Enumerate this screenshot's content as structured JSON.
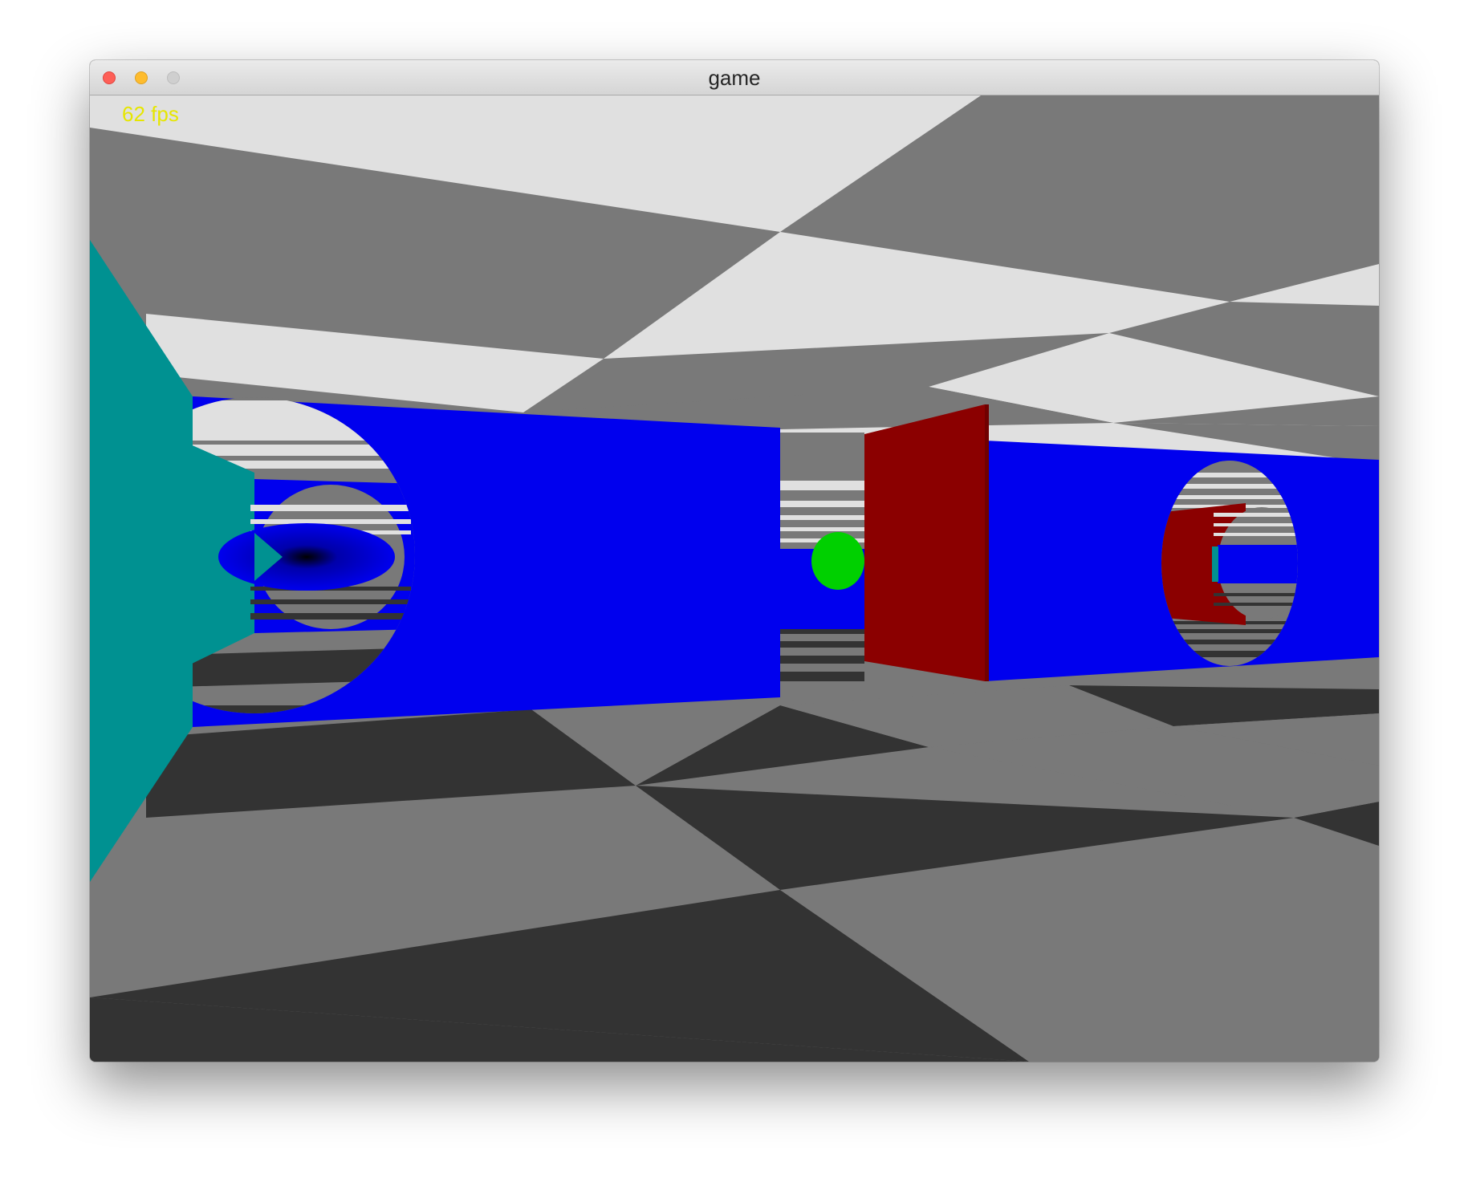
{
  "window": {
    "title": "game"
  },
  "hud": {
    "fps_text": "62 fps"
  },
  "colors": {
    "ceiling_light": "#e0e0e0",
    "ceiling_dark": "#797979",
    "floor_light": "#797979",
    "floor_dark": "#333333",
    "wall_blue": "#0000ee",
    "wall_teal": "#009191",
    "wall_red": "#8b0000",
    "sphere_green": "#00d000",
    "fps_yellow": "#e6e600"
  },
  "icons": {
    "close": "red-circle",
    "minimize": "yellow-circle",
    "maximize": "gray-circle"
  }
}
